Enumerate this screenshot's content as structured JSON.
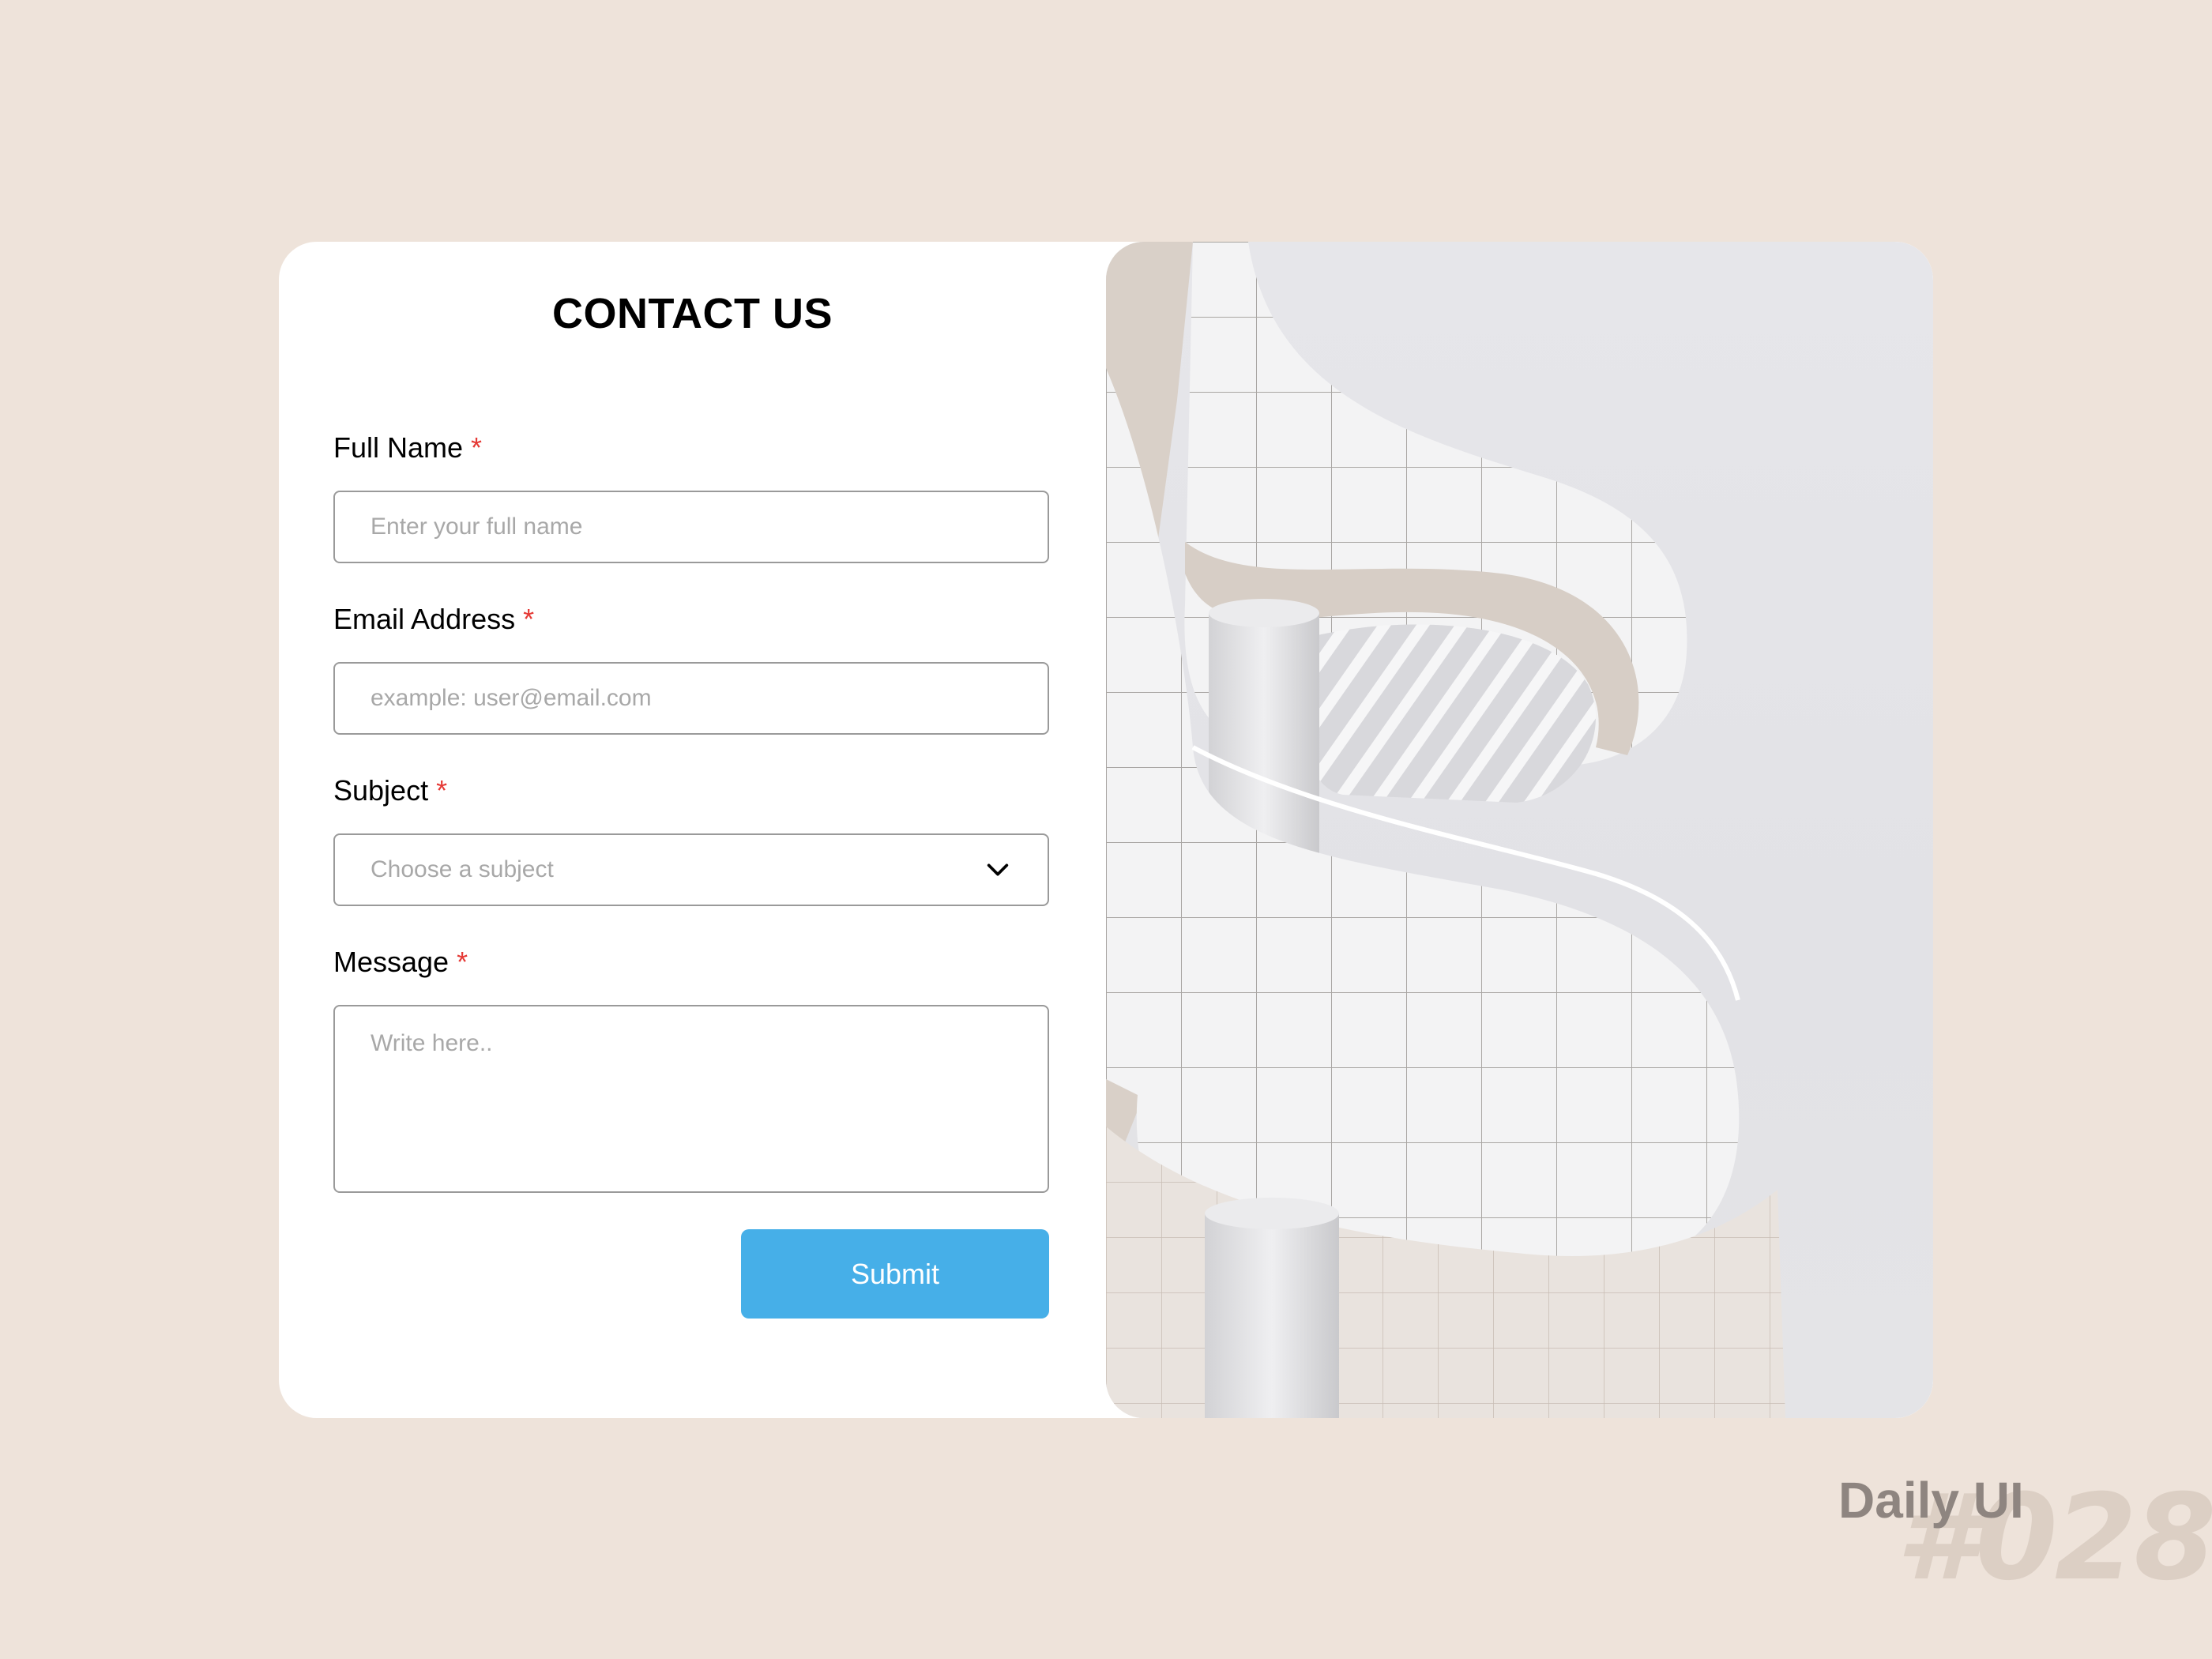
{
  "form": {
    "title": "CONTACT US",
    "required_mark": "*",
    "fields": [
      {
        "label": "Full Name",
        "placeholder": "Enter your full name",
        "type": "text"
      },
      {
        "label": "Email Address",
        "placeholder": "example: user@email.com",
        "type": "email"
      },
      {
        "label": "Subject",
        "placeholder": "Choose a subject",
        "type": "select"
      },
      {
        "label": "Message",
        "placeholder": "Write here..",
        "type": "textarea"
      }
    ],
    "submit_label": "Submit"
  },
  "branding": {
    "label": "Daily UI",
    "number": "#028"
  },
  "colors": {
    "background": "#EEE3DA",
    "card": "#FFFFFF",
    "accent": "#46AFE8",
    "required": "#E53935"
  },
  "icons": {
    "subject_dropdown": "chevron-down-icon"
  }
}
